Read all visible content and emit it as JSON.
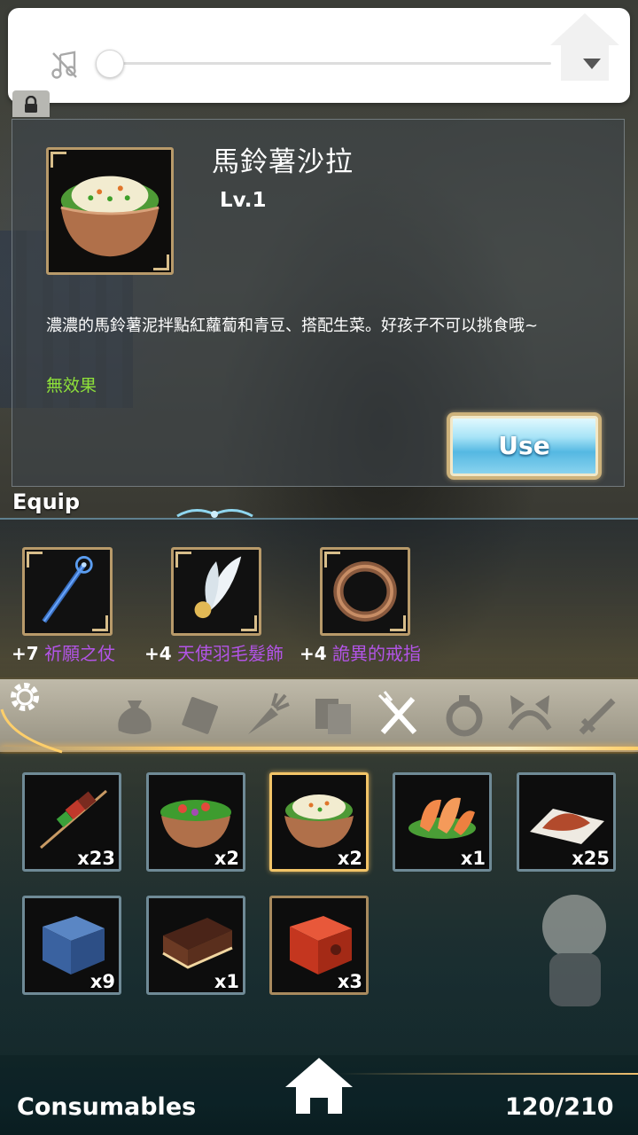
{
  "item": {
    "name": "馬鈴薯沙拉",
    "level": "Lv.1",
    "description": "濃濃的馬鈴薯泥拌點紅蘿蔔和青豆、搭配生菜。好孩子不可以挑食哦~",
    "effect": "無效果",
    "use_label": "Use"
  },
  "equip": {
    "title": "Equip",
    "slots": [
      {
        "level": "+7",
        "name": "祈願之仗",
        "icon": "staff-icon"
      },
      {
        "level": "+4",
        "name": "天使羽毛髮飾",
        "icon": "feather-hairpin-icon"
      },
      {
        "level": "+4",
        "name": "詭異的戒指",
        "icon": "ring-icon"
      }
    ]
  },
  "tabs": [
    {
      "icon": "bag-icon"
    },
    {
      "icon": "scroll-icon"
    },
    {
      "icon": "carrot-icon"
    },
    {
      "icon": "books-icon"
    },
    {
      "icon": "fork-knife-icon",
      "active": true
    },
    {
      "icon": "ring-icon"
    },
    {
      "icon": "cat-ears-icon"
    },
    {
      "icon": "sword-icon"
    }
  ],
  "inventory": [
    {
      "icon": "skewer-icon",
      "count": "x23"
    },
    {
      "icon": "salad-icon",
      "count": "x2"
    },
    {
      "icon": "potato-salad-icon",
      "count": "x2",
      "selected": true
    },
    {
      "icon": "salmon-icon",
      "count": "x1"
    },
    {
      "icon": "spice-powder-icon",
      "count": "x25"
    },
    {
      "icon": "blue-box-icon",
      "count": "x9"
    },
    {
      "icon": "chocolate-cake-icon",
      "count": "x1"
    },
    {
      "icon": "red-box-icon",
      "count": "x3"
    }
  ],
  "footer": {
    "category": "Consumables",
    "capacity": "120/210"
  },
  "colors": {
    "effect": "#8ee03a",
    "equip_name": "#b254e6",
    "selected_border": "#f2c467",
    "slot_border": "#6f8a96",
    "frame_gold": "#b89a6a"
  }
}
